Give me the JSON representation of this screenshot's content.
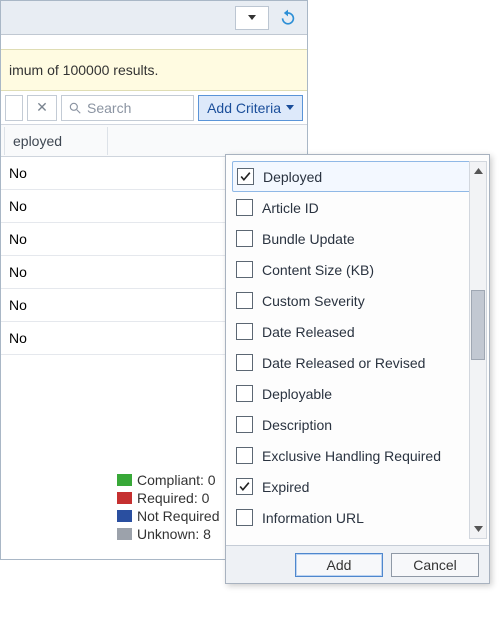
{
  "toolbar": {
    "dropdown_name": "view-dropdown",
    "refresh_name": "refresh-icon"
  },
  "info_bar": {
    "text": "imum of 100000 results."
  },
  "filter": {
    "close_label": "✕",
    "search_placeholder": "Search",
    "add_criteria_label": "Add Criteria"
  },
  "grid": {
    "header_col1": "eployed",
    "rows": [
      {
        "deployed": "No"
      },
      {
        "deployed": "No"
      },
      {
        "deployed": "No"
      },
      {
        "deployed": "No"
      },
      {
        "deployed": "No"
      },
      {
        "deployed": "No"
      }
    ]
  },
  "legend": [
    {
      "color": "#38a838",
      "label": "Compliant: 0"
    },
    {
      "color": "#c53030",
      "label": "Required: 0"
    },
    {
      "color": "#2a4fa0",
      "label": "Not Required"
    },
    {
      "color": "#9ca2ab",
      "label": "Unknown: 8"
    }
  ],
  "criteria": {
    "items": [
      {
        "label": "Deployed",
        "checked": true
      },
      {
        "label": "Article ID",
        "checked": false
      },
      {
        "label": "Bundle Update",
        "checked": false
      },
      {
        "label": "Content Size (KB)",
        "checked": false
      },
      {
        "label": "Custom Severity",
        "checked": false
      },
      {
        "label": "Date Released",
        "checked": false
      },
      {
        "label": "Date Released or Revised",
        "checked": false
      },
      {
        "label": "Deployable",
        "checked": false
      },
      {
        "label": "Description",
        "checked": false
      },
      {
        "label": "Exclusive Handling Required",
        "checked": false
      },
      {
        "label": "Expired",
        "checked": true
      },
      {
        "label": "Information URL",
        "checked": false
      }
    ],
    "add_label": "Add",
    "cancel_label": "Cancel"
  }
}
